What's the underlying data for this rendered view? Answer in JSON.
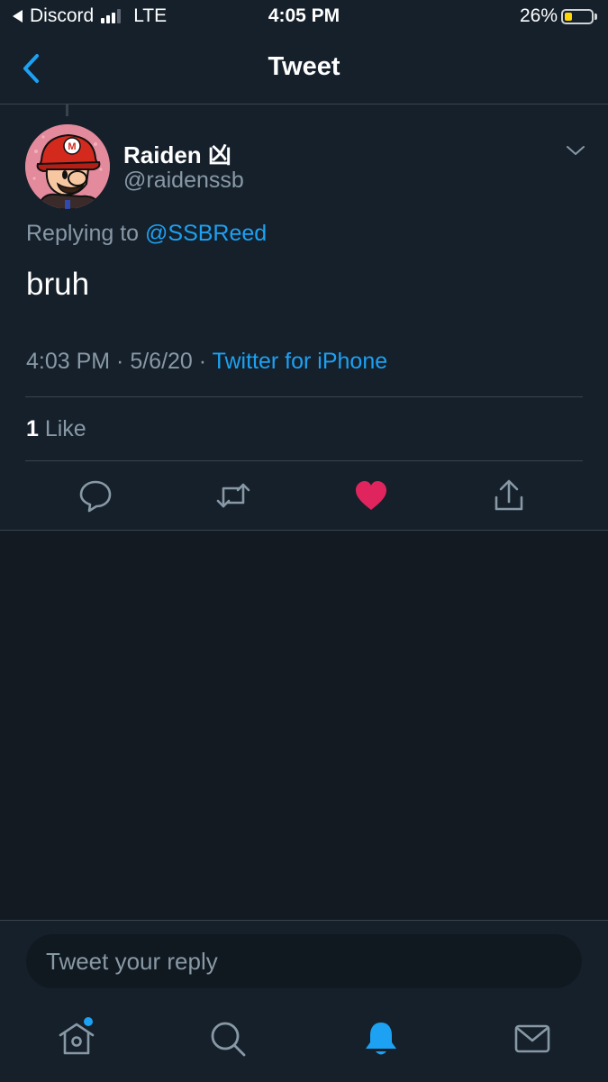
{
  "status_bar": {
    "back_app": "Discord",
    "network": "LTE",
    "time": "4:05 PM",
    "battery": "26%",
    "battery_level": 0.26,
    "signal_bars": 3
  },
  "nav": {
    "title": "Tweet"
  },
  "tweet": {
    "display_name": "Raiden 凶",
    "handle": "@raidenssb",
    "replying_prefix": "Replying to ",
    "replying_to": "@SSBReed",
    "text": "bruh",
    "timestamp": "4:03 PM · 5/6/20 · ",
    "source": "Twitter for iPhone",
    "like_count": "1",
    "like_label": " Like",
    "liked": true
  },
  "reply": {
    "placeholder": "Tweet your reply"
  },
  "icons": {
    "back": "chevron-left-icon",
    "menu": "chevron-down-icon",
    "reply": "speech-bubble-icon",
    "retweet": "retweet-icon",
    "like": "heart-icon",
    "share": "share-icon",
    "home": "home-icon",
    "search": "search-icon",
    "notifications": "bell-icon",
    "messages": "envelope-icon"
  },
  "colors": {
    "background": "#15202b",
    "accent": "#1da1f2",
    "like": "#e0245e",
    "secondary_text": "#8899a6"
  }
}
